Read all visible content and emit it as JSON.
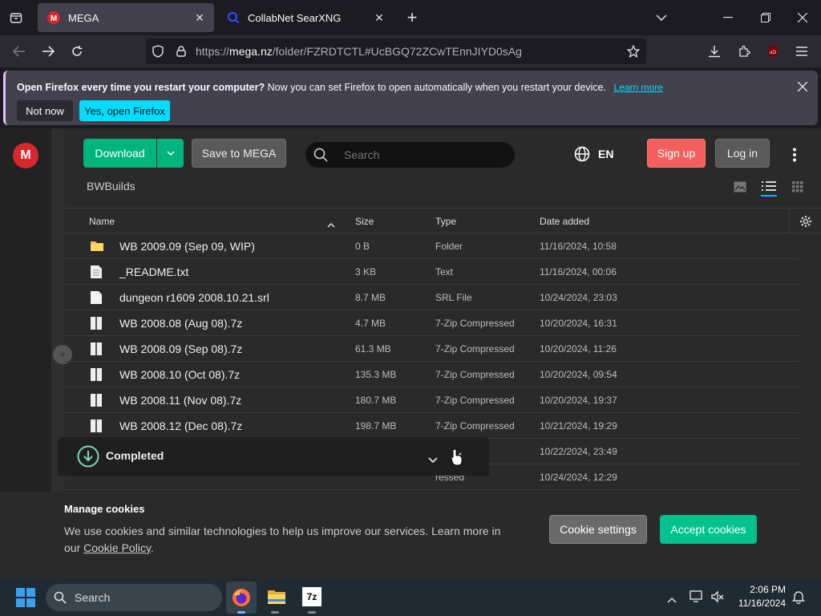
{
  "browser": {
    "tabs": [
      {
        "label": "MEGA",
        "active": true
      },
      {
        "label": "CollabNet SearXNG",
        "active": false
      }
    ],
    "url": "https://mega.nz/folder/FZRDTCTL#UcBGQ72ZCwTEnnJIYD0sAg",
    "url_host": "mega.nz",
    "url_prefix": "https://",
    "url_rest": "/folder/FZRDTCTL#UcBGQ72ZCwTEnnJIYD0sAg"
  },
  "notification": {
    "bold": "Open Firefox every time you restart your computer?",
    "text": " Now you can set Firefox to open automatically when you restart your device.",
    "link": "Learn more",
    "not_now": "Not now",
    "yes": "Yes, open Firefox"
  },
  "mega": {
    "logo": "M",
    "download": "Download",
    "save": "Save to MEGA",
    "search_placeholder": "Search",
    "language": "EN",
    "signup": "Sign up",
    "login": "Log in",
    "folder": "BWBuilds",
    "columns": {
      "name": "Name",
      "size": "Size",
      "type": "Type",
      "date": "Date added"
    },
    "files": [
      {
        "name": "WB 2009.09 (Sep 09, WIP)",
        "size": "0 B",
        "type": "Folder",
        "date": "11/16/2024, 10:58",
        "icon": "folder-icon"
      },
      {
        "name": "_README.txt",
        "size": "3 KB",
        "type": "Text",
        "date": "11/16/2024, 00:06",
        "icon": "text-file-icon"
      },
      {
        "name": "dungeon r1609 2008.10.21.srl",
        "size": "8.7 MB",
        "type": "SRL File",
        "date": "10/24/2024, 23:03",
        "icon": "generic-file-icon"
      },
      {
        "name": "WB 2008.08 (Aug 08).7z",
        "size": "4.7 MB",
        "type": "7-Zip Compressed",
        "date": "10/20/2024, 16:31",
        "icon": "archive-icon"
      },
      {
        "name": "WB 2008.09 (Sep 08).7z",
        "size": "61.3 MB",
        "type": "7-Zip Compressed",
        "date": "10/20/2024, 11:26",
        "icon": "archive-icon"
      },
      {
        "name": "WB 2008.10 (Oct 08).7z",
        "size": "135.3 MB",
        "type": "7-Zip Compressed",
        "date": "10/20/2024, 09:54",
        "icon": "archive-icon"
      },
      {
        "name": "WB 2008.11 (Nov 08).7z",
        "size": "180.7 MB",
        "type": "7-Zip Compressed",
        "date": "10/20/2024, 19:37",
        "icon": "archive-icon"
      },
      {
        "name": "WB 2008.12 (Dec 08).7z",
        "size": "198.7 MB",
        "type": "7-Zip Compressed",
        "date": "10/21/2024, 19:29",
        "icon": "archive-icon"
      },
      {
        "name": "",
        "size": "",
        "type": "ressed",
        "date": "10/22/2024, 23:49",
        "icon": "archive-icon"
      },
      {
        "name": "",
        "size": "",
        "type": "ressed",
        "date": "10/24/2024, 12:29",
        "icon": "archive-icon"
      }
    ],
    "completed": "Completed"
  },
  "cookies": {
    "title": "Manage cookies",
    "text": "We use cookies and similar technologies to help us improve our services. Learn more in",
    "text2_pre": "our ",
    "policy": "Cookie Policy",
    "text2_post": ".",
    "settings": "Cookie settings",
    "accept": "Accept cookies"
  },
  "taskbar": {
    "search": "Search",
    "time": "2:06 PM",
    "date": "11/16/2024",
    "app_7z": "7z"
  },
  "colors": {
    "mega_red": "#d9272e",
    "download_green": "#00b47e",
    "accept_green": "#00c28f",
    "signup_pink": "#f25f5c",
    "firefox_blue": "#00ddff"
  }
}
